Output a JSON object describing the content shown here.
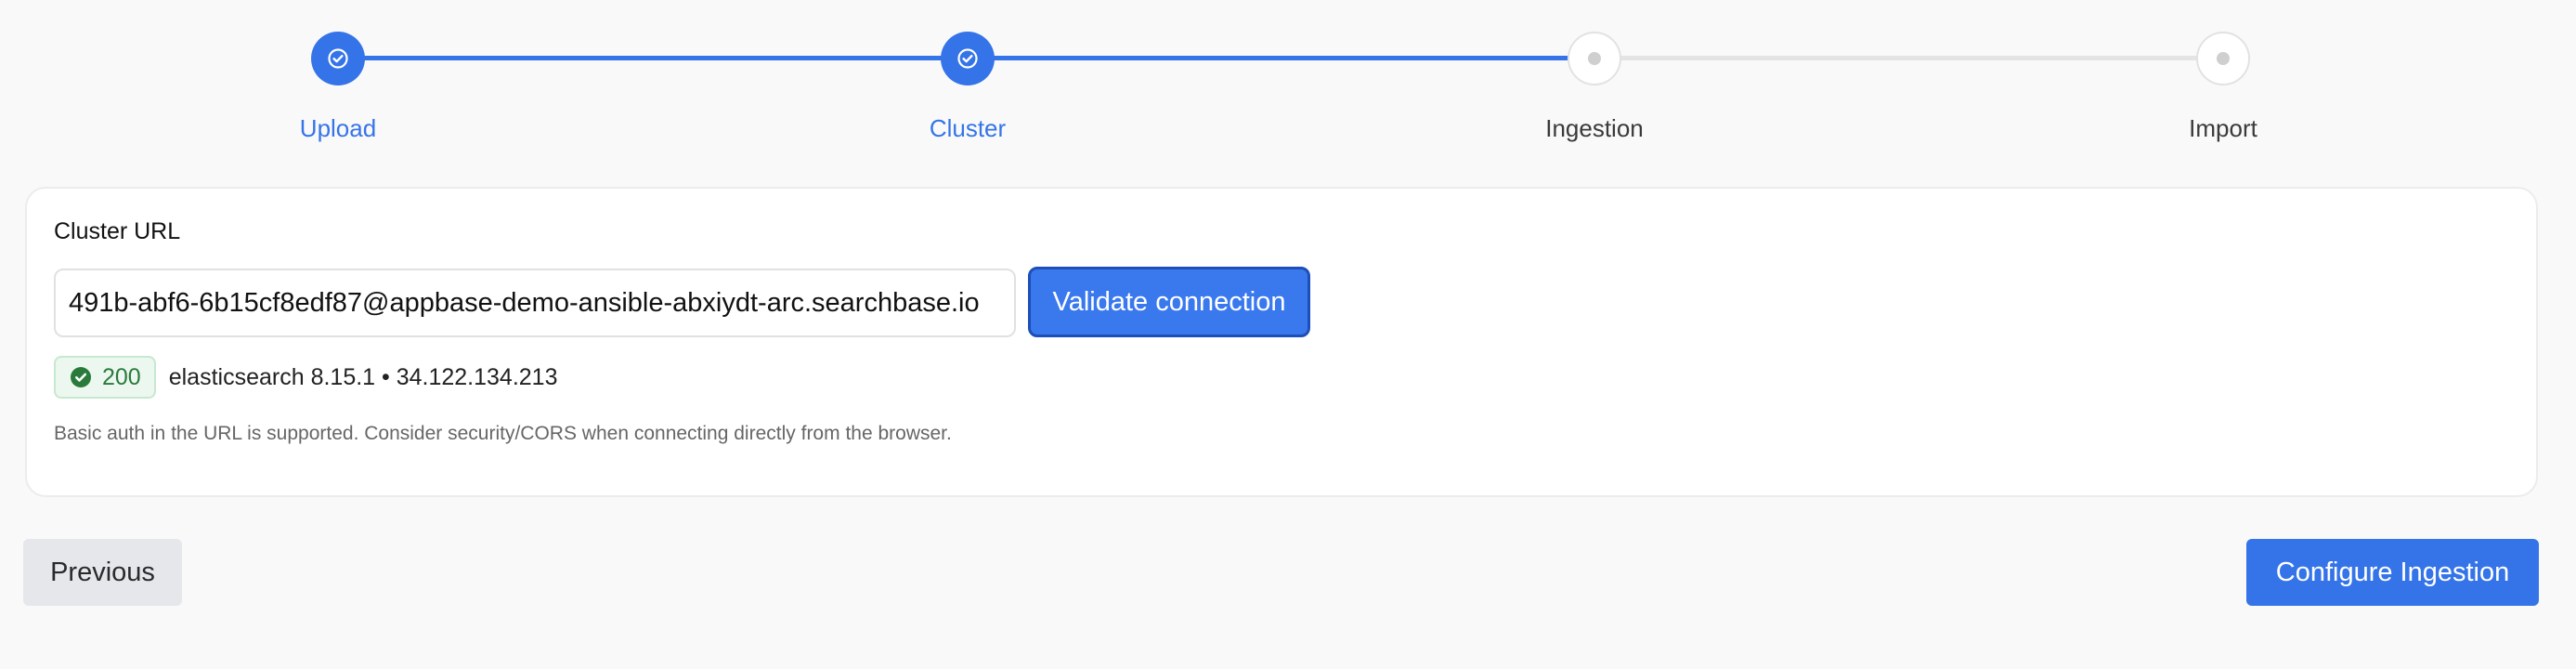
{
  "stepper": {
    "steps": [
      {
        "label": "Upload",
        "state": "done",
        "icon": "check-icon"
      },
      {
        "label": "Cluster",
        "state": "done",
        "icon": "check-icon"
      },
      {
        "label": "Ingestion",
        "state": "pending",
        "icon": "dot-icon"
      },
      {
        "label": "Import",
        "state": "pending",
        "icon": "dot-icon"
      }
    ],
    "active_color": "#3574e8",
    "inactive_color": "#e4e4e4"
  },
  "cluster": {
    "label": "Cluster URL",
    "url_value": "491b-abf6-6b15cf8edf87@appbase-demo-ansible-abxiydt-arc.searchbase.io",
    "validate_label": "Validate connection",
    "status": {
      "code": "200",
      "icon": "check-circle-icon",
      "color": "#2a7a3c",
      "details": "elasticsearch 8.15.1 • 34.122.134.213"
    },
    "help": "Basic auth in the URL is supported. Consider security/CORS when connecting directly from the browser."
  },
  "footer": {
    "previous_label": "Previous",
    "next_label": "Configure Ingestion"
  }
}
